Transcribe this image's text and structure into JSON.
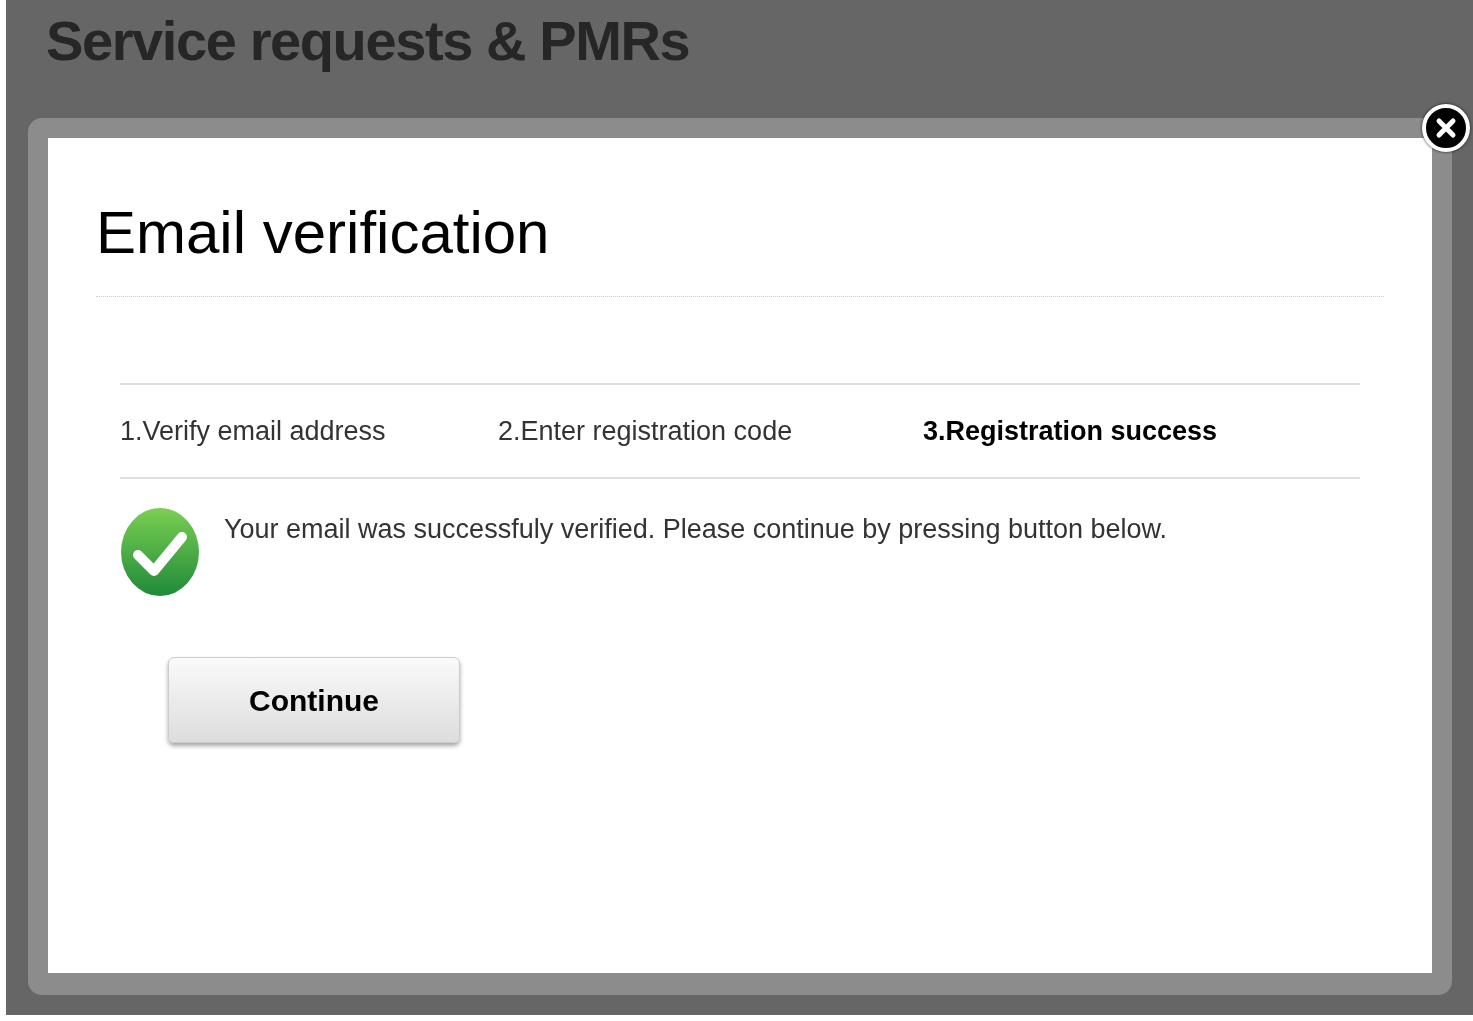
{
  "page": {
    "title": "Service requests & PMRs"
  },
  "dialog": {
    "title": "Email verification",
    "steps": [
      {
        "label": "1.Verify email address",
        "selected": false
      },
      {
        "label": "2.Enter registration code",
        "selected": false
      },
      {
        "label": "3.Registration success",
        "selected": true
      }
    ],
    "message": "Your email was successfuly verified. Please continue by pressing button below.",
    "button": "Continue"
  }
}
